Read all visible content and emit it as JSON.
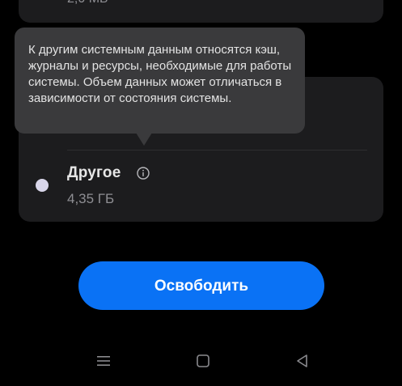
{
  "top_card": {
    "size": "2,0 МБ"
  },
  "tooltip": {
    "text": "К другим системным данным относятся кэш, журналы и ресурсы, необходимые для работы системы. Объем данных может отличаться в зависимости от состояния системы."
  },
  "storage_item": {
    "title": "Другое",
    "size": "4,35 ГБ",
    "dot_color": "#d8d6ea"
  },
  "free_button": {
    "label": "Освободить",
    "color": "#0a72f5"
  },
  "nav_bar": {
    "icons": [
      "menu-icon",
      "home-icon",
      "back-icon"
    ]
  }
}
